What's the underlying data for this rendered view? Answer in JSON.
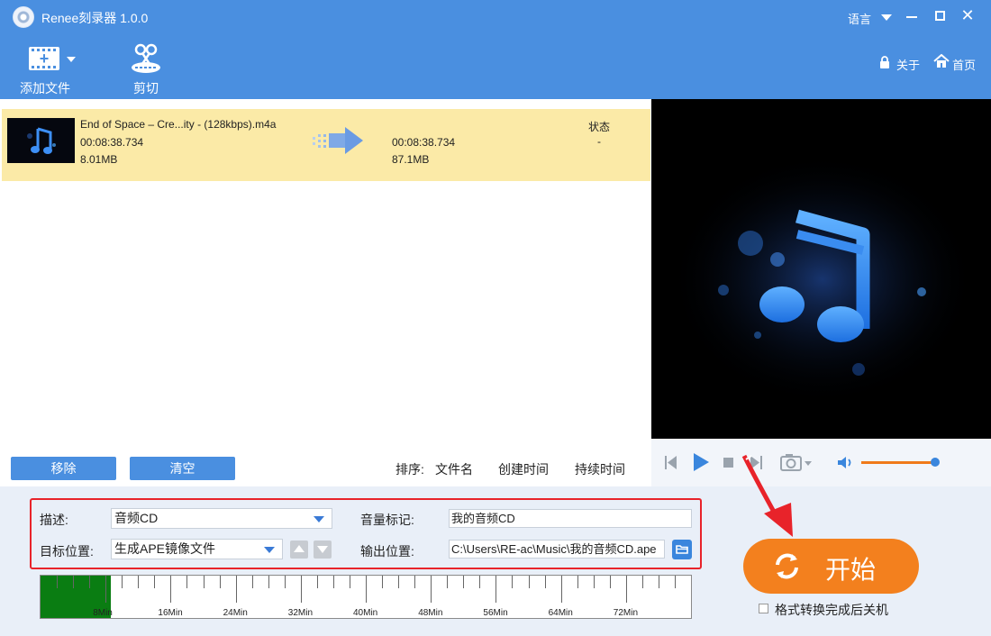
{
  "window": {
    "title": "Renee刻录器 1.0.0",
    "language_label": "语言"
  },
  "toolbar": {
    "add_file_label": "添加文件",
    "cut_label": "剪切",
    "about_label": "关于",
    "home_label": "首页"
  },
  "file_row": {
    "name": "End of Space – Cre...ity - (128kbps).m4a",
    "duration": "00:08:38.734",
    "size": "8.01MB",
    "output_duration": "00:08:38.734",
    "output_size": "87.1MB",
    "status_header": "状态",
    "status_value": "-"
  },
  "list_actions": {
    "remove_label": "移除",
    "clear_label": "清空"
  },
  "sort": {
    "label": "排序:",
    "by_filename": "文件名",
    "by_created": "创建时间",
    "by_duration": "持续时间"
  },
  "settings": {
    "description_label": "描述:",
    "description_value": "音频CD",
    "volume_label_label": "音量标记:",
    "volume_label_value": "我的音频CD",
    "target_label": "目标位置:",
    "target_value": "生成APE镜像文件",
    "output_label": "输出位置:",
    "output_value": "C:\\Users\\RE-ac\\Music\\我的音频CD.ape"
  },
  "timeline": {
    "filled_minutes": 8.65,
    "max_minutes": 80,
    "tick_labels": [
      "8Min",
      "16Min",
      "24Min",
      "32Min",
      "40Min",
      "48Min",
      "56Min",
      "64Min",
      "72Min"
    ]
  },
  "player": {
    "volume_fraction": 1.0
  },
  "start": {
    "label": "开始",
    "shutdown_label": "格式转换完成后关机",
    "shutdown_checked": false
  },
  "colors": {
    "title_bar": "#4a8fe0",
    "start_button": "#f3801e",
    "highlight_row": "#fbeaa7",
    "timeline_fill": "#0a7d12",
    "annotation_red": "#e8232a"
  },
  "icons": [
    "app-disc-icon",
    "film-add-icon",
    "scissors-icon",
    "lock-icon",
    "home-icon",
    "music-note-icon",
    "convert-arrow-icon",
    "prev-icon",
    "play-icon",
    "stop-icon",
    "next-icon",
    "camera-icon",
    "volume-icon",
    "folder-icon",
    "refresh-icon"
  ]
}
